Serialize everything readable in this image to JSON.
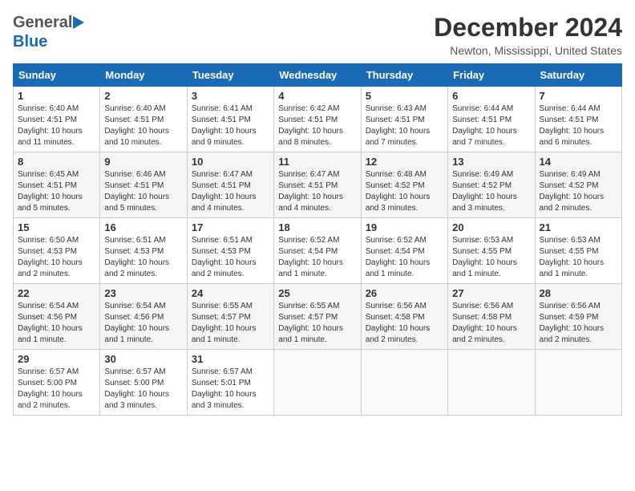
{
  "header": {
    "logo_general": "General",
    "logo_blue": "Blue",
    "title": "December 2024",
    "subtitle": "Newton, Mississippi, United States"
  },
  "calendar": {
    "days_of_week": [
      "Sunday",
      "Monday",
      "Tuesday",
      "Wednesday",
      "Thursday",
      "Friday",
      "Saturday"
    ],
    "weeks": [
      [
        {
          "day": "1",
          "lines": [
            "Sunrise: 6:40 AM",
            "Sunset: 4:51 PM",
            "Daylight: 10 hours",
            "and 11 minutes."
          ]
        },
        {
          "day": "2",
          "lines": [
            "Sunrise: 6:40 AM",
            "Sunset: 4:51 PM",
            "Daylight: 10 hours",
            "and 10 minutes."
          ]
        },
        {
          "day": "3",
          "lines": [
            "Sunrise: 6:41 AM",
            "Sunset: 4:51 PM",
            "Daylight: 10 hours",
            "and 9 minutes."
          ]
        },
        {
          "day": "4",
          "lines": [
            "Sunrise: 6:42 AM",
            "Sunset: 4:51 PM",
            "Daylight: 10 hours",
            "and 8 minutes."
          ]
        },
        {
          "day": "5",
          "lines": [
            "Sunrise: 6:43 AM",
            "Sunset: 4:51 PM",
            "Daylight: 10 hours",
            "and 7 minutes."
          ]
        },
        {
          "day": "6",
          "lines": [
            "Sunrise: 6:44 AM",
            "Sunset: 4:51 PM",
            "Daylight: 10 hours",
            "and 7 minutes."
          ]
        },
        {
          "day": "7",
          "lines": [
            "Sunrise: 6:44 AM",
            "Sunset: 4:51 PM",
            "Daylight: 10 hours",
            "and 6 minutes."
          ]
        }
      ],
      [
        {
          "day": "8",
          "lines": [
            "Sunrise: 6:45 AM",
            "Sunset: 4:51 PM",
            "Daylight: 10 hours",
            "and 5 minutes."
          ]
        },
        {
          "day": "9",
          "lines": [
            "Sunrise: 6:46 AM",
            "Sunset: 4:51 PM",
            "Daylight: 10 hours",
            "and 5 minutes."
          ]
        },
        {
          "day": "10",
          "lines": [
            "Sunrise: 6:47 AM",
            "Sunset: 4:51 PM",
            "Daylight: 10 hours",
            "and 4 minutes."
          ]
        },
        {
          "day": "11",
          "lines": [
            "Sunrise: 6:47 AM",
            "Sunset: 4:51 PM",
            "Daylight: 10 hours",
            "and 4 minutes."
          ]
        },
        {
          "day": "12",
          "lines": [
            "Sunrise: 6:48 AM",
            "Sunset: 4:52 PM",
            "Daylight: 10 hours",
            "and 3 minutes."
          ]
        },
        {
          "day": "13",
          "lines": [
            "Sunrise: 6:49 AM",
            "Sunset: 4:52 PM",
            "Daylight: 10 hours",
            "and 3 minutes."
          ]
        },
        {
          "day": "14",
          "lines": [
            "Sunrise: 6:49 AM",
            "Sunset: 4:52 PM",
            "Daylight: 10 hours",
            "and 2 minutes."
          ]
        }
      ],
      [
        {
          "day": "15",
          "lines": [
            "Sunrise: 6:50 AM",
            "Sunset: 4:53 PM",
            "Daylight: 10 hours",
            "and 2 minutes."
          ]
        },
        {
          "day": "16",
          "lines": [
            "Sunrise: 6:51 AM",
            "Sunset: 4:53 PM",
            "Daylight: 10 hours",
            "and 2 minutes."
          ]
        },
        {
          "day": "17",
          "lines": [
            "Sunrise: 6:51 AM",
            "Sunset: 4:53 PM",
            "Daylight: 10 hours",
            "and 2 minutes."
          ]
        },
        {
          "day": "18",
          "lines": [
            "Sunrise: 6:52 AM",
            "Sunset: 4:54 PM",
            "Daylight: 10 hours",
            "and 1 minute."
          ]
        },
        {
          "day": "19",
          "lines": [
            "Sunrise: 6:52 AM",
            "Sunset: 4:54 PM",
            "Daylight: 10 hours",
            "and 1 minute."
          ]
        },
        {
          "day": "20",
          "lines": [
            "Sunrise: 6:53 AM",
            "Sunset: 4:55 PM",
            "Daylight: 10 hours",
            "and 1 minute."
          ]
        },
        {
          "day": "21",
          "lines": [
            "Sunrise: 6:53 AM",
            "Sunset: 4:55 PM",
            "Daylight: 10 hours",
            "and 1 minute."
          ]
        }
      ],
      [
        {
          "day": "22",
          "lines": [
            "Sunrise: 6:54 AM",
            "Sunset: 4:56 PM",
            "Daylight: 10 hours",
            "and 1 minute."
          ]
        },
        {
          "day": "23",
          "lines": [
            "Sunrise: 6:54 AM",
            "Sunset: 4:56 PM",
            "Daylight: 10 hours",
            "and 1 minute."
          ]
        },
        {
          "day": "24",
          "lines": [
            "Sunrise: 6:55 AM",
            "Sunset: 4:57 PM",
            "Daylight: 10 hours",
            "and 1 minute."
          ]
        },
        {
          "day": "25",
          "lines": [
            "Sunrise: 6:55 AM",
            "Sunset: 4:57 PM",
            "Daylight: 10 hours",
            "and 1 minute."
          ]
        },
        {
          "day": "26",
          "lines": [
            "Sunrise: 6:56 AM",
            "Sunset: 4:58 PM",
            "Daylight: 10 hours",
            "and 2 minutes."
          ]
        },
        {
          "day": "27",
          "lines": [
            "Sunrise: 6:56 AM",
            "Sunset: 4:58 PM",
            "Daylight: 10 hours",
            "and 2 minutes."
          ]
        },
        {
          "day": "28",
          "lines": [
            "Sunrise: 6:56 AM",
            "Sunset: 4:59 PM",
            "Daylight: 10 hours",
            "and 2 minutes."
          ]
        }
      ],
      [
        {
          "day": "29",
          "lines": [
            "Sunrise: 6:57 AM",
            "Sunset: 5:00 PM",
            "Daylight: 10 hours",
            "and 2 minutes."
          ]
        },
        {
          "day": "30",
          "lines": [
            "Sunrise: 6:57 AM",
            "Sunset: 5:00 PM",
            "Daylight: 10 hours",
            "and 3 minutes."
          ]
        },
        {
          "day": "31",
          "lines": [
            "Sunrise: 6:57 AM",
            "Sunset: 5:01 PM",
            "Daylight: 10 hours",
            "and 3 minutes."
          ]
        },
        {
          "day": "",
          "lines": []
        },
        {
          "day": "",
          "lines": []
        },
        {
          "day": "",
          "lines": []
        },
        {
          "day": "",
          "lines": []
        }
      ]
    ]
  }
}
